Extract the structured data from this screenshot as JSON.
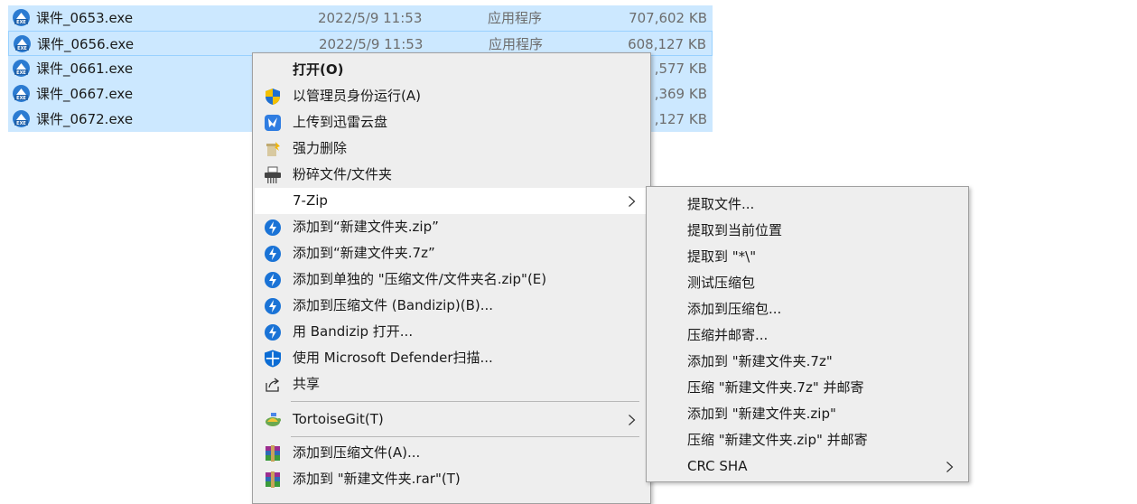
{
  "files": [
    {
      "name": "课件_0653.exe",
      "date": "2022/5/9 11:53",
      "type": "应用程序",
      "size": "707,602 KB"
    },
    {
      "name": "课件_0656.exe",
      "date": "2022/5/9 11:53",
      "type": "应用程序",
      "size": "608,127 KB"
    },
    {
      "name": "课件_0661.exe",
      "date": "",
      "type": "",
      "size": ",577 KB"
    },
    {
      "name": "课件_0667.exe",
      "date": "",
      "type": "",
      "size": ",369 KB"
    },
    {
      "name": "课件_0672.exe",
      "date": "",
      "type": "",
      "size": ",127 KB"
    }
  ],
  "context_menu": {
    "items": [
      {
        "label": "打开(O)",
        "icon": "none"
      },
      {
        "label": "以管理员身份运行(A)",
        "icon": "uac-shield-icon"
      },
      {
        "label": "上传到迅雷云盘",
        "icon": "thunder-cloud-icon"
      },
      {
        "label": "强力删除",
        "icon": "force-delete-icon"
      },
      {
        "label": "粉碎文件/文件夹",
        "icon": "shredder-icon"
      },
      {
        "label": "7-Zip",
        "icon": "none"
      },
      {
        "label": "添加到“新建文件夹.zip”",
        "icon": "bandizip-icon"
      },
      {
        "label": "添加到“新建文件夹.7z”",
        "icon": "bandizip-icon"
      },
      {
        "label": "添加到单独的 \"压缩文件/文件夹名.zip\"(E)",
        "icon": "bandizip-icon"
      },
      {
        "label": "添加到压缩文件 (Bandizip)(B)...",
        "icon": "bandizip-icon"
      },
      {
        "label": "用 Bandizip 打开...",
        "icon": "bandizip-icon"
      },
      {
        "label": "使用 Microsoft Defender扫描...",
        "icon": "defender-icon"
      },
      {
        "label": "共享",
        "icon": "share-icon"
      },
      {
        "label": "TortoiseGit(T)",
        "icon": "tortoisegit-icon"
      },
      {
        "label": "添加到压缩文件(A)...",
        "icon": "winrar-icon"
      },
      {
        "label": "添加到 \"新建文件夹.rar\"(T)",
        "icon": "winrar-icon"
      }
    ]
  },
  "submenu_7zip": {
    "items": [
      {
        "label": "提取文件..."
      },
      {
        "label": "提取到当前位置"
      },
      {
        "label": "提取到 \"*\\\""
      },
      {
        "label": "测试压缩包"
      },
      {
        "label": "添加到压缩包..."
      },
      {
        "label": "压缩并邮寄..."
      },
      {
        "label": "添加到 \"新建文件夹.7z\""
      },
      {
        "label": "压缩 \"新建文件夹.7z\" 并邮寄"
      },
      {
        "label": "添加到 \"新建文件夹.zip\""
      },
      {
        "label": "压缩 \"新建文件夹.zip\" 并邮寄"
      },
      {
        "label": "CRC SHA"
      }
    ]
  },
  "colors": {
    "selection": "#cce8ff",
    "menu_bg": "#eeeeee",
    "menu_hover": "#ffffff",
    "bandizip_blue": "#1a73d6",
    "uac_blue": "#1f6fd0",
    "uac_yellow": "#f4c000"
  }
}
